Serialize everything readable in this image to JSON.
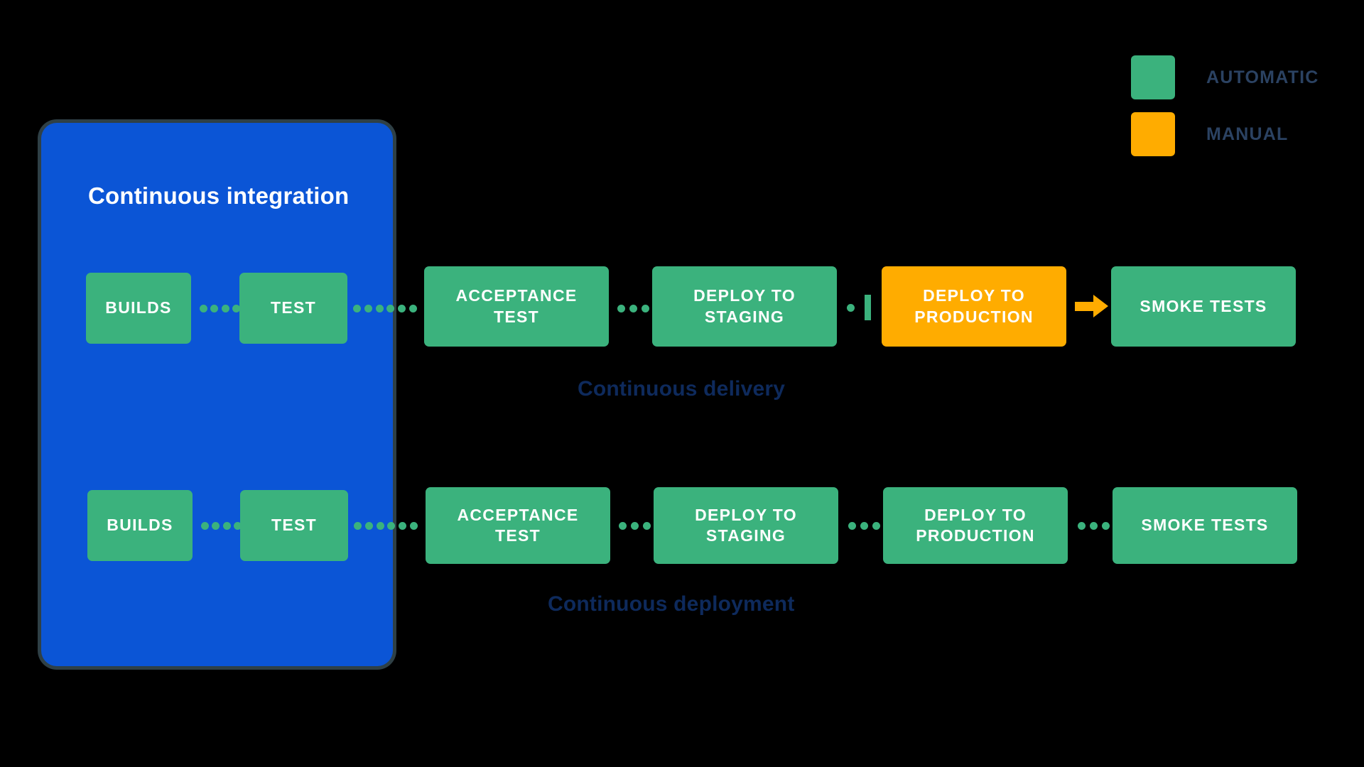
{
  "legend": {
    "items": [
      {
        "label": "AUTOMATIC",
        "color": "#3BB27D",
        "swatch_icon": "green-square-icon"
      },
      {
        "label": "MANUAL",
        "color": "#FFAC00",
        "swatch_icon": "orange-square-icon"
      }
    ],
    "label_color": "#2B4262"
  },
  "ci_panel": {
    "title": "Continuous integration",
    "fill_color": "#0B55D6",
    "border_color": "#2F4046"
  },
  "colors": {
    "automatic": "#3BB27D",
    "manual": "#FFAC00",
    "background": "#000000",
    "caption": "#0E2A5C",
    "box_text": "#FFFFFF"
  },
  "rows": [
    {
      "name": "continuous-delivery",
      "caption": "Continuous delivery",
      "stages": [
        {
          "label": "BUILDS",
          "type": "automatic",
          "inside_ci": true
        },
        {
          "label": "TEST",
          "type": "automatic",
          "inside_ci": true
        },
        {
          "label": "ACCEPTANCE TEST",
          "type": "automatic",
          "inside_ci": false
        },
        {
          "label": "DEPLOY TO STAGING",
          "type": "automatic",
          "inside_ci": false
        },
        {
          "label": "DEPLOY TO PRODUCTION",
          "type": "manual",
          "inside_ci": false
        },
        {
          "label": "SMOKE TESTS",
          "type": "automatic",
          "inside_ci": false
        }
      ],
      "connectors": [
        "dotted",
        "dotted",
        "dotted",
        "manual-gate",
        "solid-arrow"
      ]
    },
    {
      "name": "continuous-deployment",
      "caption": "Continuous deployment",
      "stages": [
        {
          "label": "BUILDS",
          "type": "automatic",
          "inside_ci": true
        },
        {
          "label": "TEST",
          "type": "automatic",
          "inside_ci": true
        },
        {
          "label": "ACCEPTANCE TEST",
          "type": "automatic",
          "inside_ci": false
        },
        {
          "label": "DEPLOY TO STAGING",
          "type": "automatic",
          "inside_ci": false
        },
        {
          "label": "DEPLOY TO PRODUCTION",
          "type": "automatic",
          "inside_ci": false
        },
        {
          "label": "SMOKE TESTS",
          "type": "automatic",
          "inside_ci": false
        }
      ],
      "connectors": [
        "dotted",
        "dotted",
        "dotted",
        "dotted",
        "dotted"
      ]
    }
  ],
  "row_top": {
    "builds": "BUILDS",
    "test": "TEST",
    "acceptance_line1": "ACCEPTANCE",
    "acceptance_line2": "TEST",
    "staging_line1": "DEPLOY TO",
    "staging_line2": "STAGING",
    "production_line1": "DEPLOY TO",
    "production_line2": "PRODUCTION",
    "smoke": "SMOKE TESTS",
    "caption": "Continuous delivery"
  },
  "row_bottom": {
    "builds": "BUILDS",
    "test": "TEST",
    "acceptance_line1": "ACCEPTANCE",
    "acceptance_line2": "TEST",
    "staging_line1": "DEPLOY TO",
    "staging_line2": "STAGING",
    "production_line1": "DEPLOY TO",
    "production_line2": "PRODUCTION",
    "smoke": "SMOKE TESTS",
    "caption": "Continuous deployment"
  }
}
